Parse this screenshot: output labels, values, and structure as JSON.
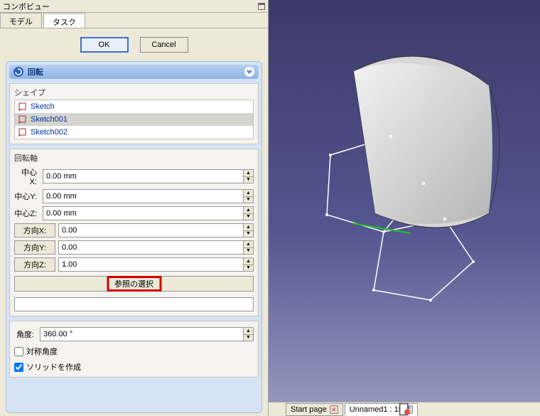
{
  "panel_title": "コンボビュー",
  "tabs": {
    "model": "モデル",
    "task": "タスク"
  },
  "buttons": {
    "ok": "OK",
    "cancel": "Cancel"
  },
  "task_header": {
    "title": "回転"
  },
  "shapes": {
    "label": "シェイプ",
    "items": [
      {
        "name": "Sketch",
        "selected": false
      },
      {
        "name": "Sketch001",
        "selected": true
      },
      {
        "name": "Sketch002",
        "selected": false
      }
    ]
  },
  "axis": {
    "label": "回転軸",
    "center_x_label": "中心X:",
    "center_x": "0.00 mm",
    "center_y_label": "中心Y:",
    "center_y": "0.00 mm",
    "center_z_label": "中心Z:",
    "center_z": "0.00 mm",
    "dir_x_label": "方向X:",
    "dir_x": "0.00",
    "dir_y_label": "方向Y:",
    "dir_y": "0.00",
    "dir_z_label": "方向Z:",
    "dir_z": "1.00",
    "select_ref": "参照の選択",
    "ref_text": ""
  },
  "angle": {
    "label": "角度:",
    "value": "360.00 °"
  },
  "checks": {
    "symmetric": "対称角度",
    "solid": "ソリッドを作成",
    "symmetric_checked": false,
    "solid_checked": true
  },
  "status_tabs": {
    "start": "Start page",
    "doc": "Unnamed1 : 1*"
  },
  "colors": {
    "highlight": "#d40000"
  }
}
